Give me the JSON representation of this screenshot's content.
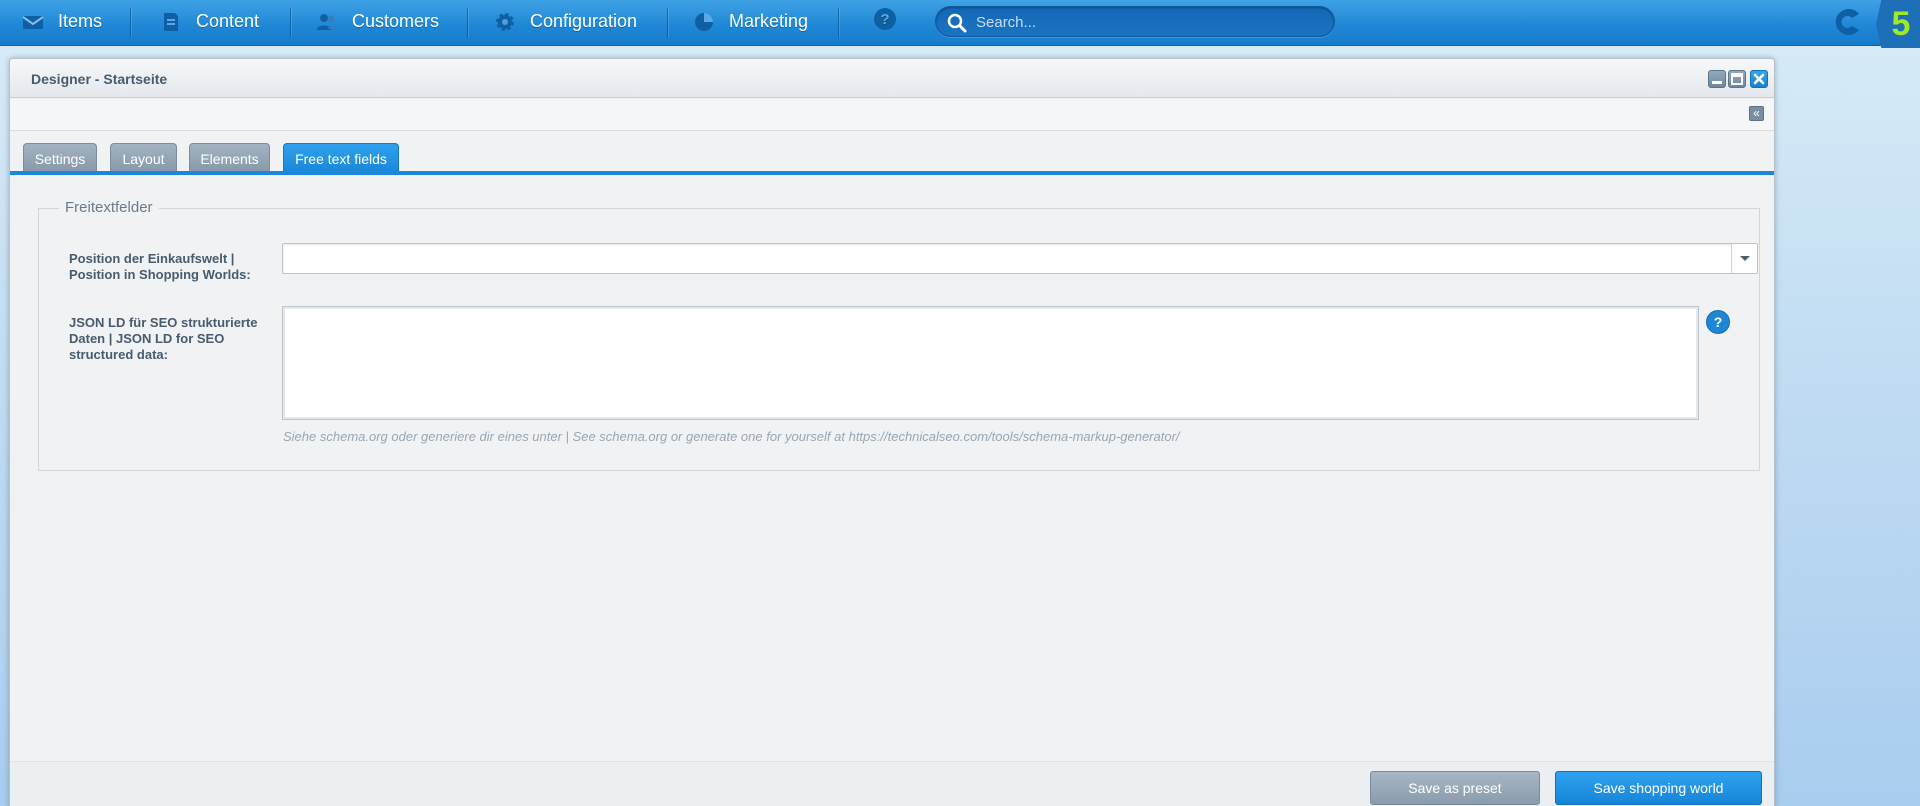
{
  "topbar": {
    "nav": [
      {
        "label": "Items",
        "icon": "inbox-icon"
      },
      {
        "label": "Content",
        "icon": "document-icon"
      },
      {
        "label": "Customers",
        "icon": "users-icon"
      },
      {
        "label": "Configuration",
        "icon": "gear-icon"
      },
      {
        "label": "Marketing",
        "icon": "pie-chart-icon"
      }
    ],
    "help_icon": "question-icon",
    "search": {
      "placeholder": "Search...",
      "value": ""
    },
    "logo": {
      "text": "5"
    }
  },
  "window": {
    "title": "Designer - Startseite",
    "collapse_glyph": "«",
    "tabs": [
      {
        "label": "Settings",
        "active": false
      },
      {
        "label": "Layout",
        "active": false
      },
      {
        "label": "Elements",
        "active": false
      },
      {
        "label": "Free text fields",
        "active": true
      }
    ],
    "fieldset": {
      "legend": "Freitextfelder",
      "position_label": "Position der Einkaufswelt | Position in Shopping Worlds:",
      "position_value": "",
      "jsonld_label": "JSON LD für SEO strukturierte Daten | JSON LD for SEO structured data:",
      "jsonld_value": "",
      "help_glyph": "?",
      "help_text": "Siehe schema.org oder generiere dir eines unter | See schema.org or generate one for yourself at https://technicalseo.com/tools/schema-markup-generator/"
    },
    "buttons": {
      "save_preset": "Save as preset",
      "save_world": "Save shopping world"
    }
  },
  "colors": {
    "accent": "#1a87d8",
    "topbar": "#2088d6",
    "logo_green": "#9fe92b"
  }
}
